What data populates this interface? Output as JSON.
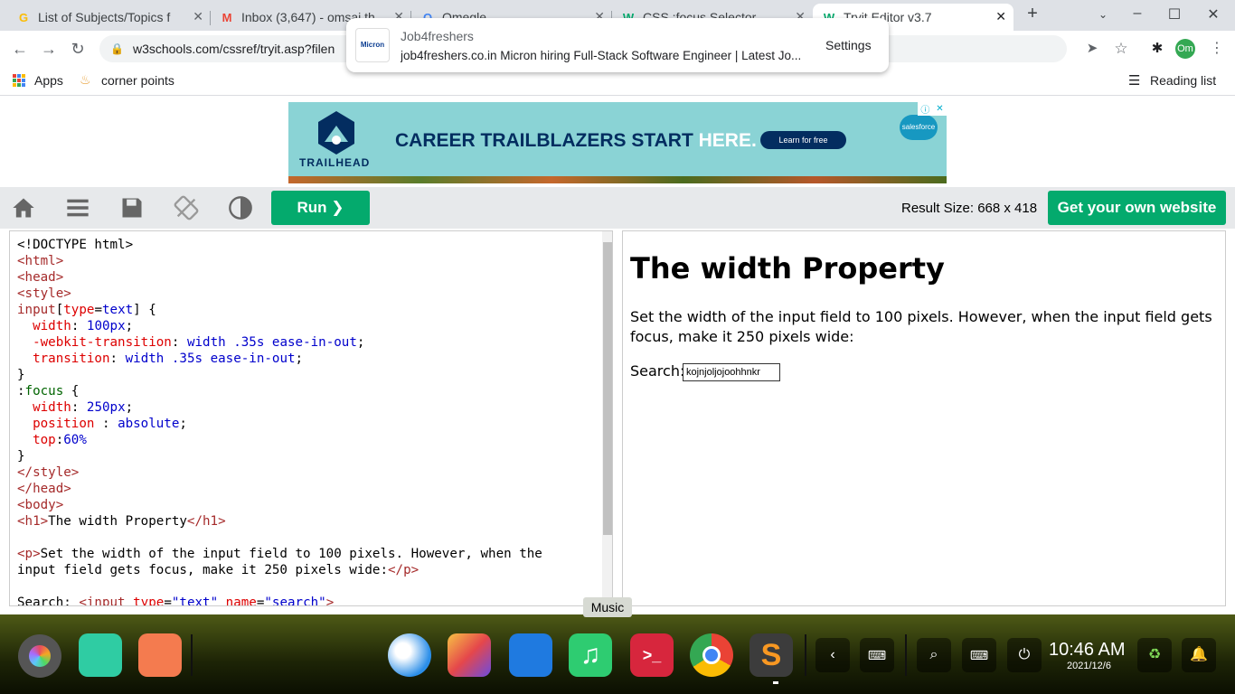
{
  "browser": {
    "tabs": [
      {
        "title": "List of Subjects/Topics f",
        "favicon": "G"
      },
      {
        "title": "Inbox (3,647) - omsai.th",
        "favicon": "M"
      },
      {
        "title": "Omegle",
        "favicon": "O"
      },
      {
        "title": "CSS :focus Selector",
        "favicon": "W"
      },
      {
        "title": "Tryit Editor v3.7",
        "favicon": "W",
        "active": true
      }
    ],
    "url": "w3schools.com/cssref/tryit.asp?filen",
    "profile_initials": "Om",
    "bookmarks": {
      "apps": "Apps",
      "item1": "corner points",
      "reading_list": "Reading list"
    }
  },
  "notification": {
    "source": "Job4freshers",
    "body": "job4freshers.co.in Micron hiring Full-Stack Software Engineer | Latest Jo...",
    "logo_text": "Micron",
    "settings": "Settings"
  },
  "ad": {
    "headline_a": "CAREER TRAILBLAZERS START ",
    "headline_b": "HERE.",
    "cta": "Learn for free",
    "brand": "TRAILHEAD",
    "partner": "salesforce"
  },
  "w3": {
    "run_label": "Run ❯",
    "result_size": "Result Size: 668 x 418",
    "get_website": "Get your own website"
  },
  "result": {
    "heading": "The width Property",
    "paragraph": "Set the width of the input field to 100 pixels. However, when the input field gets focus, make it 250 pixels wide:",
    "search_label": "Search:",
    "search_value": "kojnjoljojoohhnkr"
  },
  "taskbar": {
    "tooltip": "Music",
    "time": "10:46 AM",
    "date": "2021/12/6"
  },
  "colors": {
    "w3green": "#04aa6d",
    "tabbar": "#dee1e6",
    "adbg": "#8ad3d5"
  }
}
